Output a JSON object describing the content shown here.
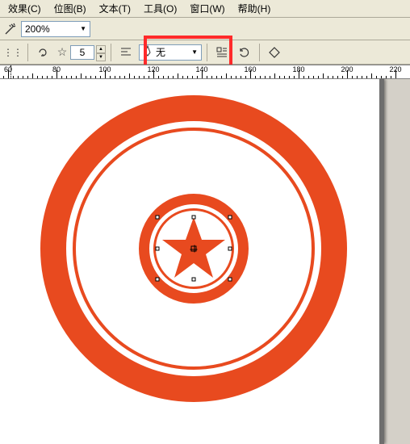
{
  "menu": {
    "effects": "效果(C)",
    "bitmap": "位图(B)",
    "text": "文本(T)",
    "tools": "工具(O)",
    "window": "窗口(W)",
    "help": "帮助(H)"
  },
  "toolbar1": {
    "magic_icon": "wand-icon",
    "zoom_value": "200%"
  },
  "toolbar2": {
    "drag_icon": "drag-handle",
    "loop_icon": "loop-icon",
    "star_points": "5",
    "align_icon": "align-left-icon",
    "pen_icon": "pen-icon",
    "pen_mode": "无",
    "textwrap_icon": "text-wrap-icon",
    "rotate_icon": "rotate-icon",
    "shape_icon": "shape-outline-icon"
  },
  "ruler": {
    "labels": [
      "60",
      "80",
      "100",
      "120",
      "140",
      "160",
      "180",
      "200"
    ],
    "marker_at": 61
  },
  "canvas": {
    "art_color": "#e84a1f",
    "star_points": 5
  }
}
